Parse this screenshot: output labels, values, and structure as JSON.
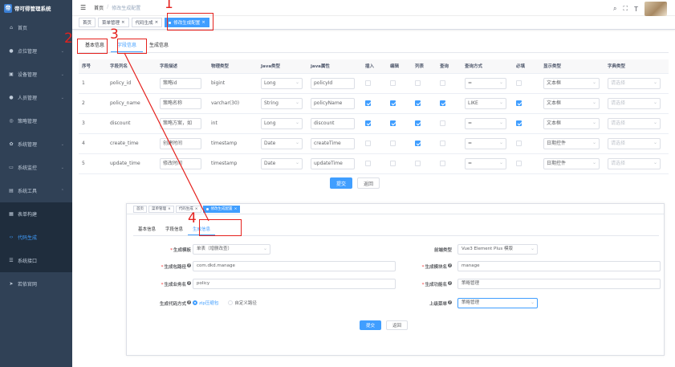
{
  "sidebar": {
    "title": "帝可得管理系统",
    "logo_char": "帝",
    "items": [
      {
        "label": "首页",
        "icon": "home-icon"
      },
      {
        "label": "点位管理",
        "icon": "location-icon"
      },
      {
        "label": "设备管理",
        "icon": "device-icon"
      },
      {
        "label": "人员管理",
        "icon": "user-icon"
      },
      {
        "label": "策略管理",
        "icon": "strategy-icon"
      },
      {
        "label": "系统管理",
        "icon": "gear-icon"
      },
      {
        "label": "系统监控",
        "icon": "monitor-icon"
      },
      {
        "label": "系统工具",
        "icon": "tool-icon"
      }
    ],
    "sub_items": [
      {
        "label": "表单构建",
        "icon": "form-icon"
      },
      {
        "label": "代码生成",
        "icon": "code-icon"
      },
      {
        "label": "系统接口",
        "icon": "api-icon"
      }
    ],
    "last_item": {
      "label": "若依官网",
      "icon": "send-icon"
    }
  },
  "header": {
    "breadcrumb": [
      "首页",
      "修改生成配置"
    ],
    "separator": "/"
  },
  "tags": [
    {
      "label": "首页",
      "closable": false,
      "active": false
    },
    {
      "label": "菜单管理",
      "closable": true,
      "active": false
    },
    {
      "label": "代码生成",
      "closable": true,
      "active": false
    },
    {
      "label": "修改生成配置",
      "closable": true,
      "active": true
    }
  ],
  "tabs": [
    "基本信息",
    "字段信息",
    "生成信息"
  ],
  "columns_table": {
    "headers": [
      "序号",
      "字段列名",
      "字段描述",
      "物理类型",
      "Java类型",
      "java属性",
      "插入",
      "编辑",
      "列表",
      "查询",
      "查询方式",
      "必填",
      "显示类型",
      "字典类型"
    ],
    "rows": [
      {
        "index": "1",
        "column": "policy_id",
        "desc": "策略id",
        "physical": "bigint",
        "java_type": "Long",
        "java_field": "policyId",
        "insert": false,
        "edit": false,
        "list": false,
        "query": false,
        "query_type": "=",
        "required": false,
        "display": "文本框",
        "dict": "请选择"
      },
      {
        "index": "2",
        "column": "policy_name",
        "desc": "策略名称",
        "physical": "varchar(30)",
        "java_type": "String",
        "java_field": "policyName",
        "insert": true,
        "edit": true,
        "list": true,
        "query": true,
        "query_type": "LIKE",
        "required": true,
        "display": "文本框",
        "dict": "请选择"
      },
      {
        "index": "3",
        "column": "discount",
        "desc": "策略方案，如",
        "physical": "int",
        "java_type": "Long",
        "java_field": "discount",
        "insert": true,
        "edit": true,
        "list": true,
        "query": false,
        "query_type": "=",
        "required": true,
        "display": "文本框",
        "dict": "请选择"
      },
      {
        "index": "4",
        "column": "create_time",
        "desc": "创建时间",
        "physical": "timestamp",
        "java_type": "Date",
        "java_field": "createTime",
        "insert": false,
        "edit": false,
        "list": true,
        "query": false,
        "query_type": "=",
        "required": false,
        "display": "日期控件",
        "dict": "请选择"
      },
      {
        "index": "5",
        "column": "update_time",
        "desc": "修改时间",
        "physical": "timestamp",
        "java_type": "Date",
        "java_field": "updateTime",
        "insert": false,
        "edit": false,
        "list": false,
        "query": false,
        "query_type": "=",
        "required": false,
        "display": "日期控件",
        "dict": "请选择"
      }
    ]
  },
  "buttons": {
    "submit": "提交",
    "back": "返回"
  },
  "inset": {
    "tags": [
      {
        "label": "首页",
        "closable": false,
        "active": false
      },
      {
        "label": "菜单管理",
        "closable": true,
        "active": false
      },
      {
        "label": "代码生成",
        "closable": true,
        "active": false
      },
      {
        "label": "修改生成配置",
        "closable": true,
        "active": true
      }
    ],
    "tabs": [
      "基本信息",
      "字段信息",
      "生成信息"
    ],
    "form": {
      "template": {
        "label": "生成模板",
        "value": "单表（增删改查）",
        "required": true
      },
      "frontend_type": {
        "label": "前端类型",
        "value": "Vue3 Element Plus 模版"
      },
      "package": {
        "label": "生成包路径",
        "value": "com.dkd.manage",
        "required": true
      },
      "module": {
        "label": "生成模块名",
        "value": "manage",
        "required": true
      },
      "business": {
        "label": "生成业务名",
        "value": "policy",
        "required": true
      },
      "function": {
        "label": "生成功能名",
        "value": "策略管理",
        "required": true
      },
      "gen_type": {
        "label": "生成代码方式",
        "options": [
          "zip压缩包",
          "自定义路径"
        ]
      },
      "parent_menu": {
        "label": "上级菜单",
        "value": "策略管理"
      }
    },
    "buttons": {
      "submit": "提交",
      "back": "返回"
    }
  },
  "annotations": [
    "1",
    "2",
    "3",
    "4"
  ],
  "colors": {
    "primary": "#409eff",
    "sidebar": "#304156",
    "annotation": "#e5211d"
  }
}
